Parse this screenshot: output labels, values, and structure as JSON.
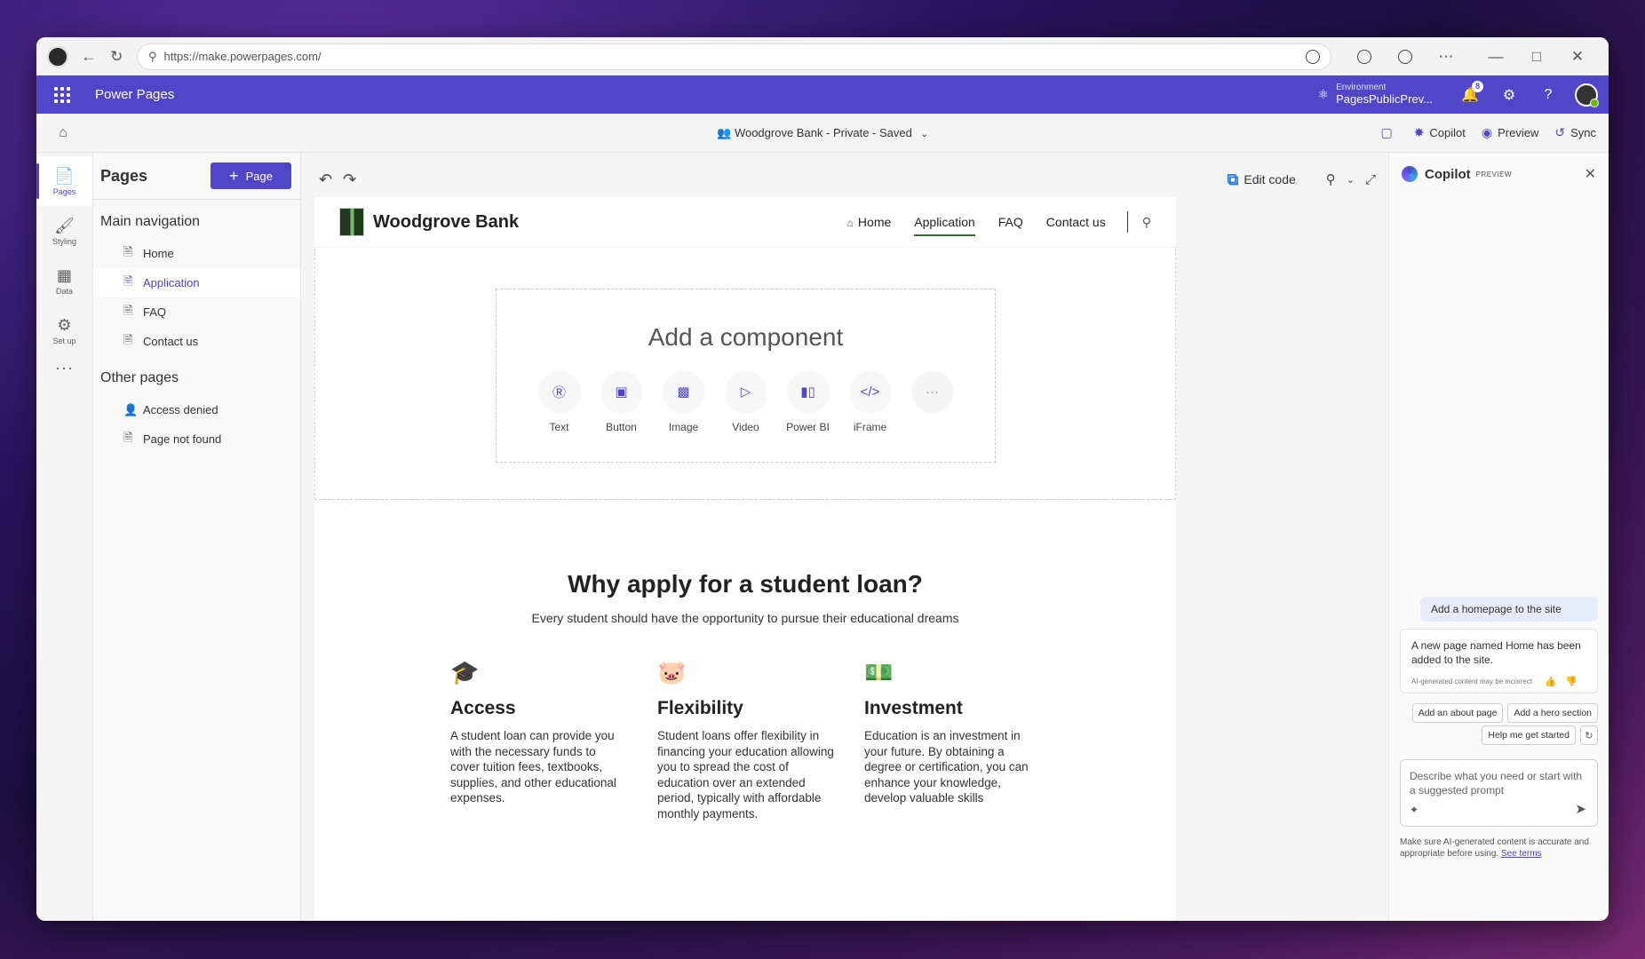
{
  "browser": {
    "url": "https://make.powerpages.com/",
    "more_icon": "ellipsis-icon"
  },
  "app": {
    "title": "Power Pages",
    "environment_label": "Environment",
    "environment_value": "PagesPublicPrev...",
    "notification_count": "8"
  },
  "command_bar": {
    "site_status": "Woodgrove Bank - Private - Saved",
    "copilot_label": "Copilot",
    "preview_label": "Preview",
    "sync_label": "Sync"
  },
  "rail": {
    "items": [
      {
        "label": "Pages"
      },
      {
        "label": "Styling"
      },
      {
        "label": "Data"
      },
      {
        "label": "Set up"
      }
    ],
    "more": "···"
  },
  "pages_pane": {
    "title": "Pages",
    "add_label": "Page",
    "main_nav_title": "Main navigation",
    "main_nav": [
      "Home",
      "Application",
      "FAQ",
      "Contact us"
    ],
    "other_title": "Other pages",
    "other": [
      "Access denied",
      "Page not found"
    ]
  },
  "canvas_toolbar": {
    "edit_code_label": "Edit code"
  },
  "site": {
    "name": "Woodgrove Bank",
    "nav": [
      "Home",
      "Application",
      "FAQ",
      "Contact us"
    ],
    "add_component_title": "Add a component",
    "components": [
      "Text",
      "Button",
      "Image",
      "Video",
      "Power BI",
      "iFrame"
    ],
    "more_component": "···",
    "why_title": "Why apply for a student loan?",
    "why_subtitle": "Every student should have the opportunity to pursue their educational dreams",
    "features": [
      {
        "title": "Access",
        "text": "A student loan can provide you with the necessary funds to cover tuition fees, textbooks, supplies, and other educational expenses."
      },
      {
        "title": "Flexibility",
        "text": "Student loans offer flexibility in financing your education allowing you to spread the cost of education over an extended period, typically with affordable monthly payments."
      },
      {
        "title": "Investment",
        "text": "Education is an investment in your future. By obtaining a degree or certification, you can enhance your knowledge, develop valuable skills"
      }
    ]
  },
  "copilot": {
    "title": "Copilot",
    "badge": "PREVIEW",
    "user_message": "Add a homepage to the site",
    "bot_message": "A new page named Home has been added to the site.",
    "ai_note": "AI-generated content may be incorrect",
    "suggestions": [
      "Add an about page",
      "Add a hero section",
      "Help me get started"
    ],
    "input_placeholder": "Describe what you need or start with a suggested prompt",
    "disclaimer": "Make sure AI-generated content is accurate and appropriate before using.",
    "see_terms": "See terms"
  }
}
